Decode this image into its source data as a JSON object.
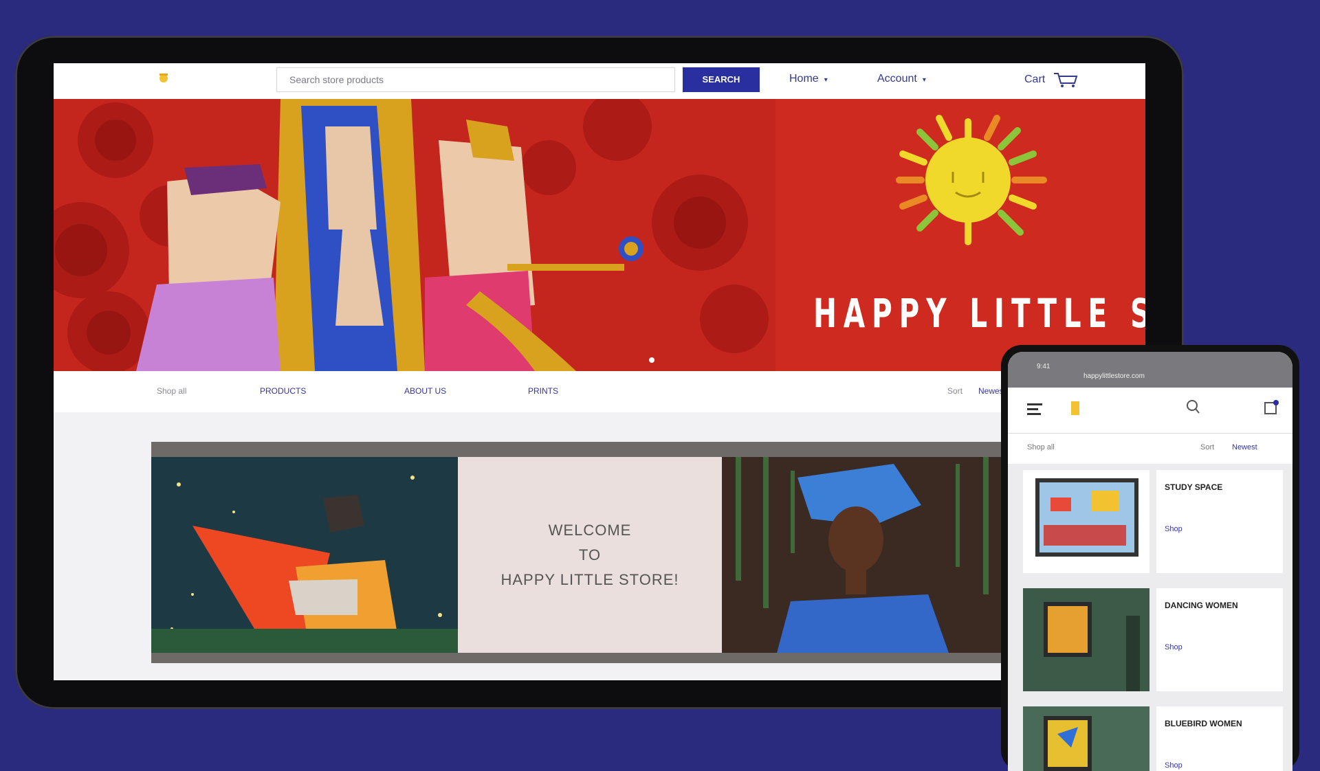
{
  "desktop": {
    "search": {
      "placeholder": "Search store products"
    },
    "search_button": "SEARCH",
    "nav": [
      {
        "label": "Home"
      },
      {
        "label": "Account"
      }
    ],
    "cart": {
      "label": "Cart"
    },
    "hero": {
      "title": "HAPPY LITTLE STORE"
    },
    "categories": [
      {
        "label": "Shop all"
      },
      {
        "label": "PRODUCTS"
      },
      {
        "label": "ABOUT US"
      },
      {
        "label": "PRINTS"
      }
    ],
    "categories_right": [
      {
        "label": "Sort"
      },
      {
        "label": "Newest"
      }
    ],
    "welcome": {
      "line1": "WELCOME",
      "line2": "TO",
      "line3": "HAPPY LITTLE STORE!"
    }
  },
  "mobile": {
    "status_time": "9:41",
    "url": "happylittlestore.com",
    "filter": {
      "left": "Shop all",
      "sort": "Sort",
      "sort_value": "Newest"
    },
    "products": [
      {
        "title": "STUDY SPACE",
        "link": "Shop"
      },
      {
        "title": "DANCING WOMEN",
        "link": "Shop"
      },
      {
        "title": "BLUEBIRD WOMEN",
        "link": "Shop"
      }
    ]
  },
  "colors": {
    "background": "#2a2a7e",
    "accent": "#2a2fa0",
    "hero_red": "#c8241c",
    "sun_yellow": "#f1d92c"
  }
}
